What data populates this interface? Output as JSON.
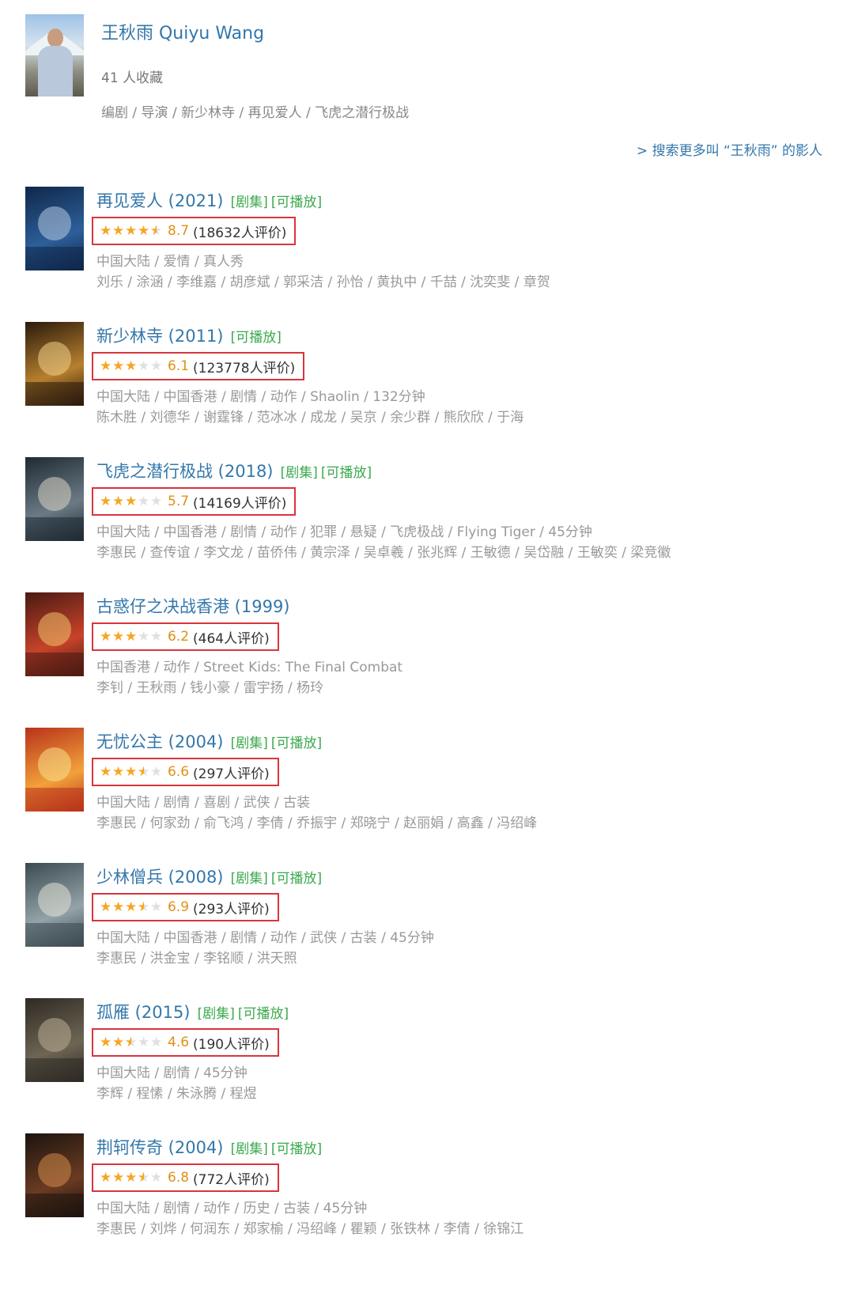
{
  "person": {
    "name": "王秋雨 Quiyu Wang",
    "collect": "41 人收藏",
    "roles": "编剧 / 导演 / 新少林寺 / 再见爱人 / 飞虎之潜行极战",
    "search_more": "> 搜索更多叫 “王秋雨” 的影人"
  },
  "colors": {
    "link": "#3377aa",
    "tag": "#3ba94d",
    "highlight_border": "#d8353d",
    "star": "#f6a623",
    "score": "#e09015"
  },
  "movies": [
    {
      "title": "再见爱人 (2021)",
      "tags": [
        "[剧集]",
        "[可播放]"
      ],
      "score": "8.7",
      "stars": 4.5,
      "votes": "(18632人评价)",
      "meta": "中国大陆 / 爱情 / 真人秀",
      "cast": "刘乐 / 涂涵 / 李维嘉 / 胡彦斌 / 郭采洁 / 孙怡 / 黄执中 / 千喆 / 沈奕斐 / 章贺",
      "poster_colors": [
        "#0f2748",
        "#2d5f9a",
        "#b7c8de"
      ]
    },
    {
      "title": "新少林寺 (2011)",
      "tags": [
        "[可播放]"
      ],
      "score": "6.1",
      "stars": 3,
      "votes": "(123778人评价)",
      "meta": "中国大陆 / 中国香港 / 剧情 / 动作 / Shaolin / 132分钟",
      "cast": "陈木胜 / 刘德华 / 谢霆锋 / 范冰冰 / 成龙 / 吴京 / 余少群 / 熊欣欣 / 于海",
      "poster_colors": [
        "#2a1a0c",
        "#b7802f",
        "#f0d08a"
      ]
    },
    {
      "title": "飞虎之潜行极战 (2018)",
      "tags": [
        "[剧集]",
        "[可播放]"
      ],
      "score": "5.7",
      "stars": 3,
      "votes": "(14169人评价)",
      "meta": "中国大陆 / 中国香港 / 剧情 / 动作 / 犯罪 / 悬疑 / 飞虎极战 / Flying Tiger / 45分钟",
      "cast": "李惠民 / 查传谊 / 李文龙 / 苗侨伟 / 黄宗泽 / 吴卓羲 / 张兆辉 / 王敏德 / 吴岱融 / 王敏奕 / 梁竞徽",
      "poster_colors": [
        "#1e2a33",
        "#6b7a85",
        "#d9d2c2"
      ]
    },
    {
      "title": "古惑仔之决战香港 (1999)",
      "tags": [],
      "score": "6.2",
      "stars": 3,
      "votes": "(464人评价)",
      "meta": "中国香港 / 动作 / Street Kids: The Final Combat",
      "cast": "李钊 / 王秋雨 / 钱小豪 / 雷宇扬 / 杨玲",
      "poster_colors": [
        "#4a1a12",
        "#c8432a",
        "#f1c36b"
      ]
    },
    {
      "title": "无忧公主 (2004)",
      "tags": [
        "[剧集]",
        "[可播放]"
      ],
      "score": "6.6",
      "stars": 3.5,
      "votes": "(297人评价)",
      "meta": "中国大陆 / 剧情 / 喜剧 / 武侠 / 古装",
      "cast": "李惠民 / 何家劲 / 俞飞鸿 / 李倩 / 乔振宇 / 郑晓宁 / 赵丽娟 / 高鑫 / 冯绍峰",
      "poster_colors": [
        "#b8321a",
        "#f2a13b",
        "#f7e08a"
      ]
    },
    {
      "title": "少林僧兵 (2008)",
      "tags": [
        "[剧集]",
        "[可播放]"
      ],
      "score": "6.9",
      "stars": 3.5,
      "votes": "(293人评价)",
      "meta": "中国大陆 / 中国香港 / 剧情 / 动作 / 武侠 / 古装 / 45分钟",
      "cast": "李惠民 / 洪金宝 / 李铭顺 / 洪天照",
      "poster_colors": [
        "#3c4a52",
        "#93a3a8",
        "#e4e1d6"
      ]
    },
    {
      "title": "孤雁 (2015)",
      "tags": [
        "[剧集]",
        "[可播放]"
      ],
      "score": "4.6",
      "stars": 2.5,
      "votes": "(190人评价)",
      "meta": "中国大陆 / 剧情 / 45分钟",
      "cast": "李辉 / 程愫 / 朱泳腾 / 程煜",
      "poster_colors": [
        "#2e2a24",
        "#6e6554",
        "#b9ad93"
      ]
    },
    {
      "title": "荆轲传奇 (2004)",
      "tags": [
        "[剧集]",
        "[可播放]"
      ],
      "score": "6.8",
      "stars": 3.5,
      "votes": "(772人评价)",
      "meta": "中国大陆 / 剧情 / 动作 / 历史 / 古装 / 45分钟",
      "cast": "李惠民 / 刘烨 / 何润东 / 郑家榆 / 冯绍峰 / 瞿颖 / 张铁林 / 李倩 / 徐锦江",
      "poster_colors": [
        "#1c140f",
        "#6a3b22",
        "#d08b4b"
      ]
    }
  ]
}
